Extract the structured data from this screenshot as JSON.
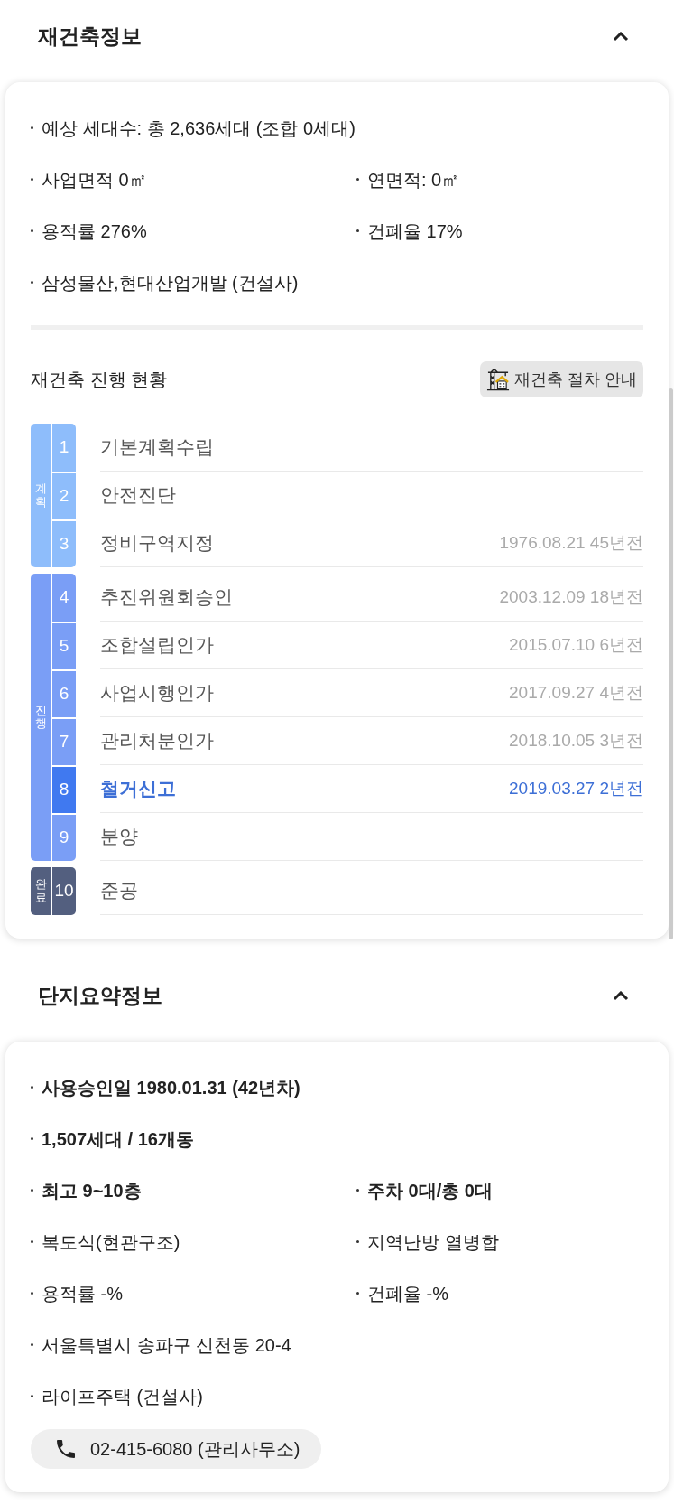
{
  "sections": [
    {
      "title": "재건축정보",
      "expanded": true,
      "facts": [
        {
          "cells": [
            {
              "text": "예상 세대수: 총 2,636세대 (조합 0세대)",
              "bold": false
            }
          ]
        },
        {
          "cells": [
            {
              "text": "사업면적 0㎡",
              "bold": false
            },
            {
              "text": "연면적: 0㎡",
              "bold": false
            }
          ]
        },
        {
          "cells": [
            {
              "text": "용적률 276%",
              "bold": false
            },
            {
              "text": "건폐율 17%",
              "bold": false
            }
          ]
        },
        {
          "cells": [
            {
              "text": "삼성물산,현대산업개발 (건설사)",
              "bold": false
            }
          ]
        }
      ],
      "progress": {
        "title": "재건축 진행 현황",
        "guide_button": "재건축 절차 안내",
        "stages": [
          {
            "label": "계획",
            "color": "#8ebdfb",
            "steps": [
              {
                "number": "1",
                "name": "기본계획수립",
                "selected": false
              },
              {
                "number": "2",
                "name": "안전진단",
                "selected": false
              },
              {
                "number": "3",
                "name": "정비구역지정",
                "date": "1976.08.21 45년전",
                "selected": false
              }
            ]
          },
          {
            "label": "진행",
            "color": "#7a9ef6",
            "steps": [
              {
                "number": "4",
                "name": "추진위원회승인",
                "date": "2003.12.09 18년전",
                "selected": false
              },
              {
                "number": "5",
                "name": "조합설립인가",
                "date": "2015.07.10 6년전",
                "selected": false
              },
              {
                "number": "6",
                "name": "사업시행인가",
                "date": "2017.09.27 4년전",
                "selected": false
              },
              {
                "number": "7",
                "name": "관리처분인가",
                "date": "2018.10.05 3년전",
                "selected": false
              },
              {
                "number": "8",
                "name": "철거신고",
                "date": "2019.03.27 2년전",
                "selected": true
              },
              {
                "number": "9",
                "name": "분양",
                "selected": false
              }
            ]
          },
          {
            "label": "완료",
            "color": "#535f7f",
            "steps": [
              {
                "number": "10",
                "name": "준공",
                "selected": false
              }
            ]
          }
        ]
      }
    },
    {
      "title": "단지요약정보",
      "expanded": true,
      "facts": [
        {
          "cells": [
            {
              "text": "사용승인일 1980.01.31 (42년차)",
              "bold": true
            }
          ]
        },
        {
          "cells": [
            {
              "text": "1,507세대 / 16개동",
              "bold": true
            }
          ]
        },
        {
          "cells": [
            {
              "text": "최고 9~10층",
              "bold": true
            },
            {
              "text": "주차 0대/총 0대",
              "bold": true
            }
          ]
        },
        {
          "cells": [
            {
              "text": "복도식(현관구조)",
              "bold": false
            },
            {
              "text": "지역난방 열병합",
              "bold": false
            }
          ]
        },
        {
          "cells": [
            {
              "text": "용적률 -%",
              "bold": false
            },
            {
              "text": "건폐율 -%",
              "bold": false
            }
          ]
        },
        {
          "cells": [
            {
              "text": "서울특별시 송파구 신천동 20-4",
              "bold": false
            }
          ]
        },
        {
          "cells": [
            {
              "text": "라이프주택 (건설사)",
              "bold": false
            }
          ]
        }
      ],
      "phone": "02-415-6080 (관리사무소)"
    }
  ]
}
